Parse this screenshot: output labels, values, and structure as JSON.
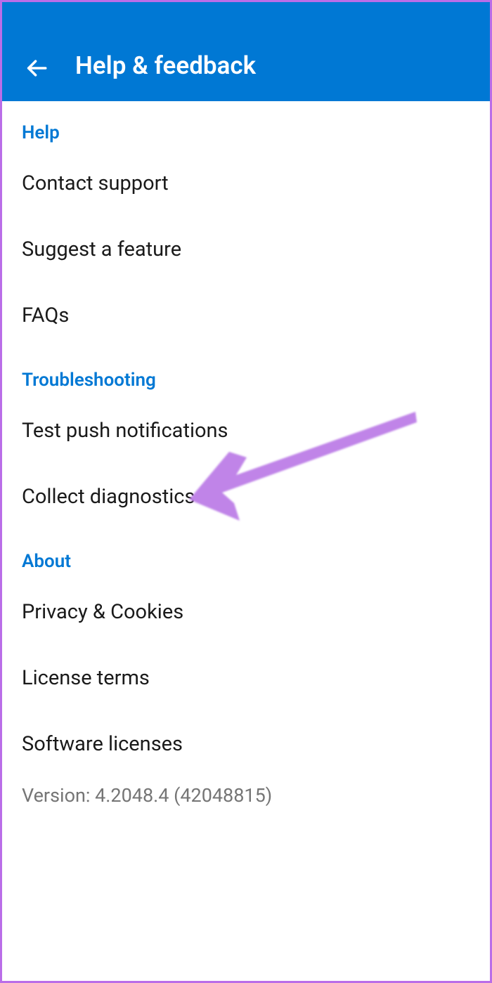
{
  "header": {
    "title": "Help & feedback"
  },
  "sections": {
    "help": {
      "title": "Help",
      "items": {
        "contact_support": "Contact support",
        "suggest_feature": "Suggest a feature",
        "faqs": "FAQs"
      }
    },
    "troubleshooting": {
      "title": "Troubleshooting",
      "items": {
        "test_push": "Test push notifications",
        "collect_diagnostics": "Collect diagnostics"
      }
    },
    "about": {
      "title": "About",
      "items": {
        "privacy": "Privacy & Cookies",
        "license_terms": "License terms",
        "software_licenses": "Software licenses"
      }
    }
  },
  "version": "Version: 4.2048.4 (42048815)",
  "colors": {
    "primary": "#0078d4",
    "annotation": "#c084e8"
  }
}
